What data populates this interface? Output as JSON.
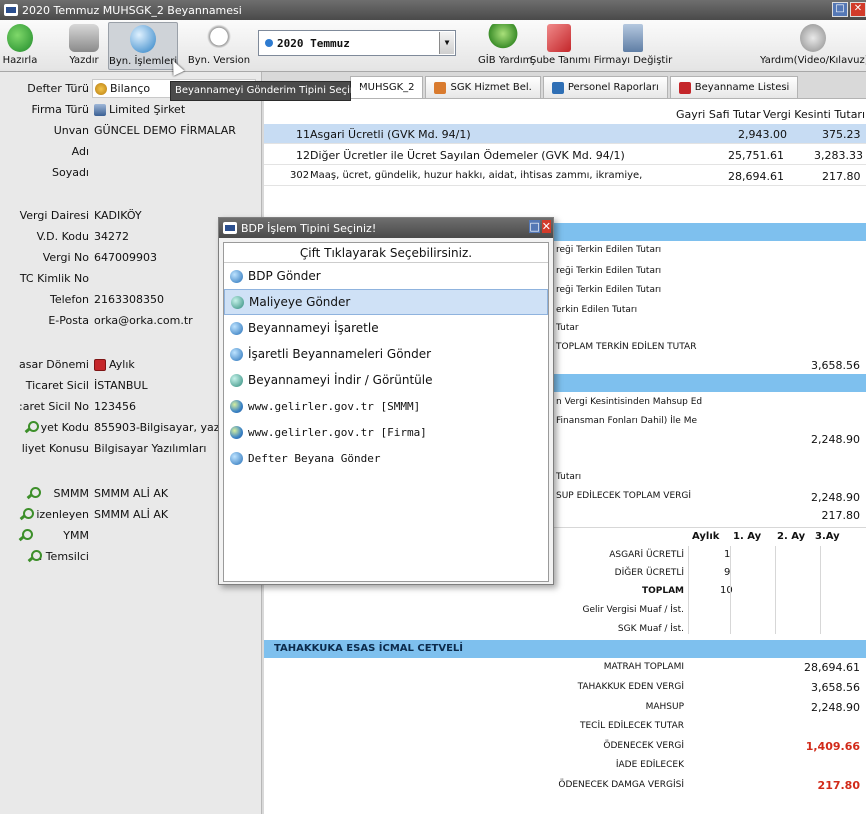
{
  "window": {
    "title": "2020 Temmuz MUHSGK_2 Beyannamesi"
  },
  "toolbar": {
    "hazirla": "Hazırla",
    "yazdir": "Yazdır",
    "byn_islemleri": "Byn. İşlemleri",
    "byn_version": "Byn. Version",
    "period": "2020 Temmuz",
    "gib_yardim": "GİB Yardım",
    "sube_tanimi": "Şube Tanımı",
    "firmayi_degistir": "Firmayı Değiştir",
    "yardim_video": "Yardım(Video/Kılavuz)"
  },
  "tooltip": "Beyannameyi Gönderim Tipini Seçiniz.",
  "left": {
    "rows": [
      {
        "label": "Defter Türü",
        "value": "Bilanço"
      },
      {
        "label": "Firma Türü",
        "value": "Limited Şirket"
      },
      {
        "label": "Unvan",
        "value": "GÜNCEL DEMO FİRMALAR"
      },
      {
        "label": "Adı",
        "value": ""
      },
      {
        "label": "Soyadı",
        "value": ""
      },
      {
        "label": "Vergi Dairesi",
        "value": "KADIKÖY"
      },
      {
        "label": "V.D. Kodu",
        "value": "34272"
      },
      {
        "label": "Vergi No",
        "value": "647009903"
      },
      {
        "label": "TC Kimlik No",
        "value": ""
      },
      {
        "label": "Telefon",
        "value": "2163308350"
      },
      {
        "label": "E-Posta",
        "value": "orka@orka.com.tr"
      },
      {
        "label": "asar Dönemi",
        "value": "Aylık"
      },
      {
        "label": "Ticaret Sicil",
        "value": "İSTANBUL"
      },
      {
        "label": ":aret Sicil No",
        "value": "123456"
      },
      {
        "label": "yet Kodu",
        "value": "855903-Bilgisayar, yazılım,"
      },
      {
        "label": "liyet Konusu",
        "value": "Bilgisayar Yazılımları"
      },
      {
        "label": "SMMM",
        "value": "SMMM ALİ AK"
      },
      {
        "label": "izenleyen",
        "value": "SMMM ALİ AK"
      },
      {
        "label": "YMM",
        "value": ""
      },
      {
        "label": "ı Temsilci",
        "value": ""
      }
    ]
  },
  "tabs": [
    {
      "label": "MUHSGK_2"
    },
    {
      "label": "SGK Hizmet Bel."
    },
    {
      "label": "Personel Raporları"
    },
    {
      "label": "Beyanname Listesi"
    }
  ],
  "table": {
    "col_gross": "Gayri Safi Tutar",
    "col_tax": "Vergi Kesinti Tutarı",
    "rows": [
      {
        "code": "11",
        "desc": "Asgari Ücretli (GVK Md. 94/1)",
        "gross": "2,943.00",
        "tax": "375.23"
      },
      {
        "code": "12",
        "desc": "Diğer Ücretler ile Ücret Sayılan Ödemeler (GVK Md. 94/1)",
        "gross": "25,751.61",
        "tax": "3,283.33"
      },
      {
        "code": "302",
        "desc": "Maaş, ücret, gündelik, huzur hakkı, aidat, ihtisas zammı, ikramiye,",
        "gross": "28,694.61",
        "tax": "217.80"
      }
    ]
  },
  "fragments": [
    "reği Terkin Edilen Tutarı",
    "reği Terkin Edilen Tutarı",
    "reği Terkin Edilen Tutarı",
    "erkin Edilen Tutarı",
    "Tutar",
    "TOPLAM TERKİN EDİLEN TUTAR",
    "n Vergi Kesintisinden Mahsup Ed",
    "Finansman Fonları Dahil) İle Me",
    "Tutarı",
    "SUP EDİLECEK TOPLAM VERGİ"
  ],
  "mid_values": {
    "v1": "3,658.56",
    "v2": "2,248.90",
    "v3": "2,248.90",
    "v4": "217.80"
  },
  "workers": {
    "hdr_aylik": "Aylık",
    "hdr_1ay": "1. Ay",
    "hdr_2ay": "2. Ay",
    "hdr_3ay": "3.Ay",
    "rows": [
      {
        "label": "ASGARİ ÜCRETLİ",
        "value": "1"
      },
      {
        "label": "DİĞER ÜCRETLİ",
        "value": "9"
      },
      {
        "label": "TOPLAM",
        "value": "10"
      },
      {
        "label": "Gelir Vergisi Muaf / İst.",
        "value": ""
      },
      {
        "label": "SGK Muaf / İst.",
        "value": ""
      }
    ]
  },
  "icmal": {
    "title": "TAHAKKUKA ESAS İCMAL CETVELİ",
    "rows": [
      {
        "label": "MATRAH TOPLAMI",
        "value": "28,694.61"
      },
      {
        "label": "TAHAKKUK EDEN VERGİ",
        "value": "3,658.56"
      },
      {
        "label": "MAHSUP",
        "value": "2,248.90"
      },
      {
        "label": "TECİL EDİLECEK TUTAR",
        "value": ""
      },
      {
        "label": "ÖDENECEK VERGİ",
        "value": "1,409.66"
      },
      {
        "label": "İADE EDİLECEK",
        "value": ""
      },
      {
        "label": "ÖDENECEK DAMGA VERGİSİ",
        "value": "217.80"
      }
    ]
  },
  "dialog": {
    "title": "BDP İşlem Tipini Seçiniz!",
    "header": "Çift Tıklayarak Seçebilirsiniz.",
    "items": [
      {
        "label": "BDP Gönder",
        "icon": "blue"
      },
      {
        "label": "Maliyeye Gönder",
        "icon": "teal"
      },
      {
        "label": "Beyannameyi İşaretle",
        "icon": "blue"
      },
      {
        "label": "İşaretli Beyannameleri Gönder",
        "icon": "blue"
      },
      {
        "label": "Beyannameyi İndir / Görüntüle",
        "icon": "teal"
      },
      {
        "label": "www.gelirler.gov.tr [SMMM]",
        "icon": "globe"
      },
      {
        "label": "www.gelirler.gov.tr [Firma]",
        "icon": "globe"
      },
      {
        "label": "Defter Beyana Gönder",
        "icon": "blue"
      }
    ]
  },
  "colors": {
    "accent_band": "#7ec0ee",
    "selection": "#c7dcf3",
    "red_value": "#d22a19"
  }
}
